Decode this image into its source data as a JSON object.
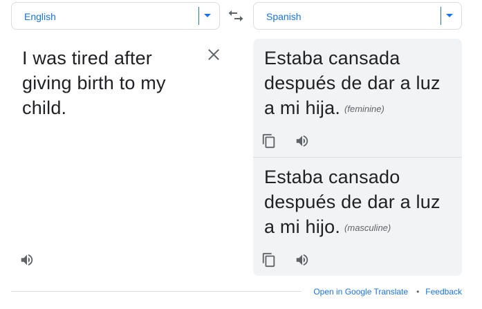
{
  "source_lang": {
    "label": "English"
  },
  "target_lang": {
    "label": "Spanish"
  },
  "source": {
    "text": "I was tired after giving birth to my child."
  },
  "results": [
    {
      "text": "Estaba cansada después de dar a luz a mi hija.",
      "gender": "(feminine)"
    },
    {
      "text": "Estaba cansado después de dar a luz a mi hijo.",
      "gender": "(masculine)"
    }
  ],
  "footer": {
    "open_link": "Open in Google Translate",
    "separator": "•",
    "feedback_link": "Feedback"
  },
  "colors": {
    "accent": "#1a73e8",
    "icon": "#5f6368",
    "text": "#202124",
    "panel_bg": "#f1f3f4"
  },
  "icons": [
    "dropdown-arrow-icon",
    "swap-icon",
    "close-icon",
    "speaker-icon",
    "copy-icon"
  ]
}
